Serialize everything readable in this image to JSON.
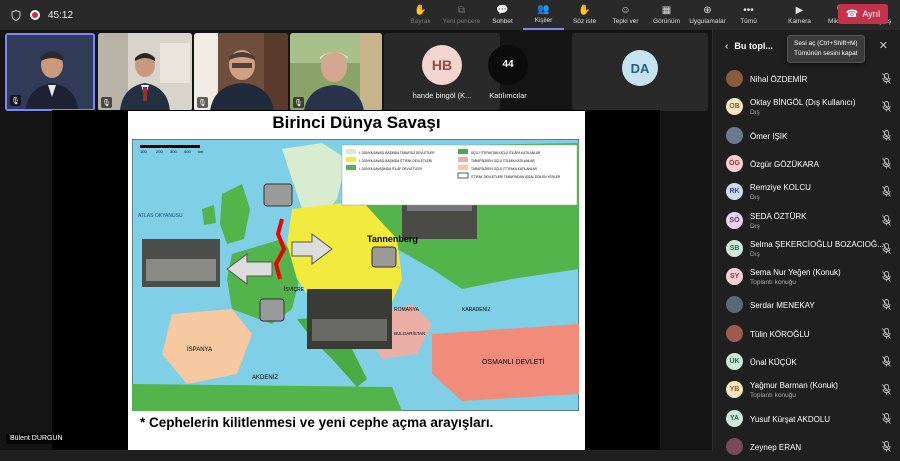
{
  "topbar": {
    "timer": "45:12",
    "tools": [
      {
        "label": "Bayrak",
        "icon": "hand-flag-icon",
        "glyph": "✋",
        "dim": true
      },
      {
        "label": "Yeni pencere",
        "icon": "new-window-icon",
        "glyph": "⧉",
        "dim": true
      },
      {
        "label": "Sohbet",
        "icon": "chat-icon",
        "glyph": "💬",
        "dim": false
      },
      {
        "label": "Kişiler",
        "icon": "people-icon",
        "glyph": "👥",
        "dim": false,
        "active": true
      },
      {
        "label": "Söz iste",
        "icon": "raise-hand-icon",
        "glyph": "✋",
        "dim": false
      },
      {
        "label": "Tepki ver",
        "icon": "reaction-icon",
        "glyph": "☺",
        "dim": false
      },
      {
        "label": "Görünüm",
        "icon": "view-icon",
        "glyph": "▦",
        "dim": false
      },
      {
        "label": "Uygulamalar",
        "icon": "apps-icon",
        "glyph": "⊕",
        "dim": false
      },
      {
        "label": "Tümü",
        "icon": "more-icon",
        "glyph": "•••",
        "dim": false
      },
      {
        "label": "Kamera",
        "icon": "camera-icon",
        "glyph": "▶",
        "dim": false
      },
      {
        "label": "Mikrofon",
        "icon": "microphone-icon",
        "glyph": "🎙",
        "dim": false
      },
      {
        "label": "Paylaş",
        "icon": "share-icon",
        "glyph": "⇪",
        "dim": false
      }
    ],
    "leave_label": "Ayrıl"
  },
  "gallery": {
    "avatars": [
      {
        "initials": "HB",
        "name": "hande bingöl (K...",
        "bg": "#f3d6cf",
        "fg": "#a04a3a"
      },
      {
        "initials": "44",
        "name": "Katılımcılar",
        "bg": "#0b0b0b",
        "fg": "#ffffff"
      },
      {
        "initials": "DA",
        "name": "",
        "bg": "#c8e3f0",
        "fg": "#1f5f8b"
      }
    ]
  },
  "slide": {
    "title": "Birinci Dünya Savaşı",
    "bullet": "*   Cephelerin kilitlenmesi ve yeni cephe açma arayışları.",
    "legend": [
      "I. DÜNYA SAVAŞI BAŞINDA TARAFSIZ DEVLETLER",
      "I. DÜNYA SAVAŞI BAŞINDA İTTİFAK DEVLETLERİ",
      "I. DÜNYA SAVAŞINDA İTİLÂF DEVLETLERİ",
      "ÜÇLÜ İTTİFAKTAN ÜÇLÜ İTİLÂFA KATILANLAR",
      "TARAFSIZKEN ÜÇLÜ İTİLAFA KATILANLAR",
      "TARAFSIZKEN ÜÇLÜ İTTİFAKA KATILANLAR",
      "İTTİFAK DEVLETLERİ TARAFINDAN İŞGAL EDİLEN YERLER"
    ],
    "map_labels": [
      "Tannenberg",
      "ATLAS OKYANUSU",
      "İSPANYA",
      "AKDENİZ",
      "KARADENİZ",
      "OSMANLI DEVLETİ",
      "ROMANYA",
      "BULGARİSTAN",
      "İSVİÇRE"
    ],
    "scale": [
      "100",
      "200",
      "300",
      "400",
      "km"
    ]
  },
  "speaker_name": "Bülent DURGUN",
  "panel": {
    "title": "Bu topl...",
    "tooltip_line1": "Sesi aç (Ctrl+Shift+M)",
    "tooltip_line2": "Tümünün sesini kapat",
    "participants": [
      {
        "initials": "",
        "name": "Nihal ÖZDEMİR",
        "sub": "",
        "bg": "#8a5b3c",
        "fg": "#ffffff"
      },
      {
        "initials": "OB",
        "name": "Oktay BİNGÖL (Dış Kullanıcı)",
        "sub": "Dış",
        "bg": "#f5e6c3",
        "fg": "#8a6a1a"
      },
      {
        "initials": "",
        "name": "Ömer IŞIK",
        "sub": "",
        "bg": "#6b7b8c",
        "fg": "#ffffff"
      },
      {
        "initials": "ÖG",
        "name": "Özgür GÖZÜKARA",
        "sub": "",
        "bg": "#f6d0d4",
        "fg": "#a3303c"
      },
      {
        "initials": "RK",
        "name": "Remziye KOLCU",
        "sub": "Dış",
        "bg": "#d4d9f2",
        "fg": "#3b4a9a"
      },
      {
        "initials": "SÖ",
        "name": "SEDA ÖZTÜRK",
        "sub": "Dış",
        "bg": "#e7d4ef",
        "fg": "#6a3a86"
      },
      {
        "initials": "SB",
        "name": "Selma ŞEKERCİOĞLU BOZACIOĞ...",
        "sub": "Dış",
        "bg": "#cfe8dc",
        "fg": "#2c6e4b"
      },
      {
        "initials": "SY",
        "name": "Sema Nur Yeğen (Konuk)",
        "sub": "Toplantı konuğu",
        "bg": "#f6d0d4",
        "fg": "#a3303c"
      },
      {
        "initials": "",
        "name": "Serdar MENEKAY",
        "sub": "",
        "bg": "#5a6878",
        "fg": "#ffffff"
      },
      {
        "initials": "",
        "name": "Tülin KÖROĞLU",
        "sub": "",
        "bg": "#9b5c4b",
        "fg": "#ffffff"
      },
      {
        "initials": "ÜK",
        "name": "Ünal KÜÇÜK",
        "sub": "",
        "bg": "#cfe8dc",
        "fg": "#2c6e4b"
      },
      {
        "initials": "YB",
        "name": "Yağmur Barman (Konuk)",
        "sub": "Toplantı konuğu",
        "bg": "#f5e6c3",
        "fg": "#8a6a1a"
      },
      {
        "initials": "YA",
        "name": "Yusuf Kürşat AKDOLU",
        "sub": "",
        "bg": "#cfe8dc",
        "fg": "#2c6e4b"
      },
      {
        "initials": "",
        "name": "Zeynep ERAN",
        "sub": "",
        "bg": "#7a4a5a",
        "fg": "#ffffff"
      }
    ]
  }
}
